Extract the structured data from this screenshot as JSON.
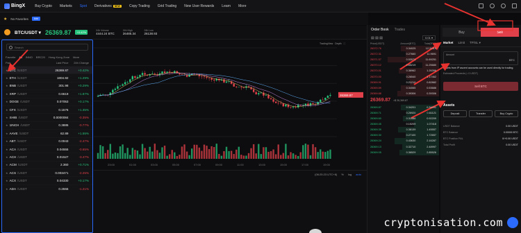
{
  "nav": {
    "brand": "BingX",
    "items": [
      {
        "label": "Buy Crypto",
        "active": false
      },
      {
        "label": "Markets",
        "active": false
      },
      {
        "label": "Spot",
        "active": true
      },
      {
        "label": "Derivatives",
        "active": false,
        "badge": "NEW"
      },
      {
        "label": "Copy Trading",
        "active": false
      },
      {
        "label": "Grid Trading",
        "active": false
      },
      {
        "label": "New User Rewards",
        "active": false
      },
      {
        "label": "Learn",
        "active": false
      },
      {
        "label": "More",
        "active": false
      }
    ]
  },
  "favbar": {
    "label": "No Favorites",
    "chip": "Add"
  },
  "ticker": {
    "pair": "BTC/USDT",
    "price": "26369.87",
    "change": "+0.42%",
    "stats": [
      {
        "label": "24h Volume",
        "value": "4444.24 BTC"
      },
      {
        "label": "24h High",
        "value": "26485.34"
      },
      {
        "label": "24h Low",
        "value": "26138.93"
      }
    ]
  },
  "market": {
    "search_placeholder": "Search",
    "tabs": [
      "Favorite",
      "All",
      "INNO",
      "BRC20",
      "Hong Kong Zone",
      "More"
    ],
    "active_tab": "All",
    "headers": [
      "Pair",
      "Last Price",
      "24h Change"
    ],
    "rows": [
      {
        "base": "BTC",
        "quote": "/USDT",
        "price": "26369.87",
        "change": "+0.42%",
        "dir": "up"
      },
      {
        "base": "ETH",
        "quote": "/USDT",
        "price": "1804.82",
        "change": "+1.29%",
        "dir": "up"
      },
      {
        "base": "BNB",
        "quote": "/USDT",
        "price": "301.98",
        "change": "+0.29%",
        "dir": "up"
      },
      {
        "base": "XRP",
        "quote": "/USDT",
        "price": "0.6619",
        "change": "+1.87%",
        "dir": "up"
      },
      {
        "base": "DOGE",
        "quote": "/USDT",
        "price": "0.07053",
        "change": "+0.17%",
        "dir": "up"
      },
      {
        "base": "CFX",
        "quote": "/USDT",
        "price": "0.1576",
        "change": "+1.35%",
        "dir": "up"
      },
      {
        "base": "SHIB",
        "quote": "/USDT",
        "price": "0.0000084",
        "change": "-0.35%",
        "dir": "down"
      },
      {
        "base": "1INCH",
        "quote": "/USDT",
        "price": "0.3885",
        "change": "-0.77%",
        "dir": "down"
      },
      {
        "base": "AAVE",
        "quote": "/USDT",
        "price": "62.89",
        "change": "+1.55%",
        "dir": "up"
      },
      {
        "base": "ABT",
        "quote": "/USDT",
        "price": "0.0043",
        "change": "-2.47%",
        "dir": "down"
      },
      {
        "base": "ACA",
        "quote": "/USDT",
        "price": "0.04555",
        "change": "-0.65%",
        "dir": "down"
      },
      {
        "base": "ACH",
        "quote": "/USDT",
        "price": "0.01527",
        "change": "-3.47%",
        "dir": "down"
      },
      {
        "base": "ACM",
        "quote": "/USDT",
        "price": "2.360",
        "change": "+0.71%",
        "dir": "up"
      },
      {
        "base": "ACS",
        "quote": "/USDT",
        "price": "0.003471",
        "change": "-2.25%",
        "dir": "down"
      },
      {
        "base": "ACX",
        "quote": "/USDT",
        "price": "0.04330",
        "change": "+0.17%",
        "dir": "up"
      },
      {
        "base": "ADA",
        "quote": "/USDT",
        "price": "0.2555",
        "change": "-1.21%",
        "dir": "down"
      }
    ]
  },
  "chart": {
    "toolbar": [
      "TradingView",
      "Depth",
      "⛶"
    ],
    "price_tag": "26369.87",
    "time_labels": [
      "23:00",
      "01:00",
      "03:00",
      "05:00",
      "07:00",
      "09:00",
      "11:00",
      "13:00",
      "15:00",
      "17:00",
      "19:00"
    ],
    "footer_time": "(06:25:23 UTC+8)",
    "footer_opts": [
      "%",
      "log",
      "auto"
    ]
  },
  "orderbook": {
    "tabs": [
      "Order Book",
      "Trades"
    ],
    "precision": "0.01",
    "headers": [
      "Price(USDT)",
      "Amount(BTC)",
      "Total(BTC)"
    ],
    "asks": [
      {
        "p": "26372.76",
        "a": "0.34025",
        "t": "12.31119"
      },
      {
        "p": "26372.31",
        "a": "0.27660",
        "t": "11.9691"
      },
      {
        "p": "26371.57",
        "a": "0.53571",
        "t": "11.69251"
      },
      {
        "p": "26370.12",
        "a": "0.65219",
        "t": "11.25680"
      },
      {
        "p": "26370.01",
        "a": "0.36962",
        "t": "1.26396"
      },
      {
        "p": "26370.00",
        "a": "0.26540",
        "t": "1.17462"
      },
      {
        "p": "26369.91",
        "a": "0.21210",
        "t": "0.82882"
      },
      {
        "p": "26369.89",
        "a": "0.34065",
        "t": "0.53686"
      },
      {
        "p": "26369.88",
        "a": "0.39306",
        "t": "0.39306"
      }
    ],
    "mid_price": "26369.87",
    "mid_sub": "≈$ 26,369.87",
    "bids": [
      {
        "p": "26369.87",
        "a": "0.34201",
        "t": "0.34201"
      },
      {
        "p": "26369.71",
        "a": "0.26920",
        "t": "0.61121"
      },
      {
        "p": "26369.60",
        "a": "0.31088",
        "t": "0.92209"
      },
      {
        "p": "26369.45",
        "a": "0.15209",
        "t": "1.07418"
      },
      {
        "p": "26369.39",
        "a": "0.38139",
        "t": "1.45557"
      },
      {
        "p": "26369.30",
        "a": "0.27100",
        "t": "1.72657"
      },
      {
        "p": "26369.24",
        "a": "0.43630",
        "t": "2.16287"
      },
      {
        "p": "26369.13",
        "a": "0.32710",
        "t": "2.48997"
      },
      {
        "p": "26369.05",
        "a": "0.36529",
        "t": "2.85526"
      }
    ]
  },
  "trade": {
    "buy_label": "Buy",
    "sell_label": "Sell",
    "order_types": [
      "Market",
      "Limit",
      "TP/SL"
    ],
    "amount_label": "Amount",
    "amount_unit": "BTC",
    "warning": "Assets from IP ascent accounts can be used directly for trading.",
    "estimate": "Estimated Proceeds (≈ 0 USDT)",
    "sell_button": "Sell BTC",
    "assets_title": "Assets",
    "asset_buttons": [
      "Deposit",
      "Transfer",
      "Buy Crypto"
    ],
    "balances": [
      {
        "label": "USDT Balance",
        "value": "0.00 USDT"
      },
      {
        "label": "BTC Balance",
        "value": "0.00000 BTC"
      },
      {
        "label": "BTC Position P&L",
        "value": "0/+0.00 USDT"
      },
      {
        "label": "Total Profit",
        "value": "0.00 USDT"
      }
    ]
  },
  "watermark": "cryptonisation.com",
  "colors": {
    "up": "#27c27b",
    "down": "#e0404a",
    "accent": "#2b6bff",
    "annotation": "#e8322f"
  }
}
